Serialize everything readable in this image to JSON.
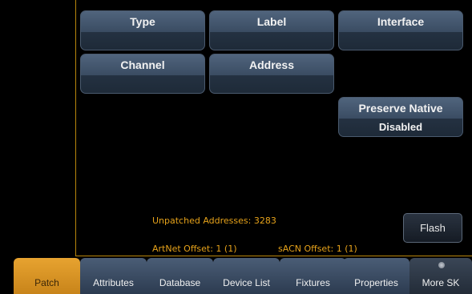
{
  "fields": {
    "type": {
      "label": "Type",
      "value": ""
    },
    "label": {
      "label": "Label",
      "value": ""
    },
    "interface": {
      "label": "Interface",
      "value": ""
    },
    "channel": {
      "label": "Channel",
      "value": ""
    },
    "address": {
      "label": "Address",
      "value": ""
    },
    "preserve_native": {
      "label": "Preserve Native",
      "value": "Disabled"
    }
  },
  "status": {
    "unpatched": "Unpatched Addresses: 3283",
    "artnet": "ArtNet Offset: 1 (1)",
    "sacn": "sACN Offset: 1 (1)"
  },
  "flash_button": "Flash",
  "softkeys": [
    {
      "label": "Patch",
      "active": true
    },
    {
      "label": "Attributes"
    },
    {
      "label": "Database"
    },
    {
      "label": "Device List"
    },
    {
      "label": "Fixtures"
    },
    {
      "label": "Properties"
    },
    {
      "label": "More SK"
    }
  ],
  "colors": {
    "accent": "#e7a330",
    "status_text": "#e6a21a",
    "field_header": "#3a4c62"
  }
}
